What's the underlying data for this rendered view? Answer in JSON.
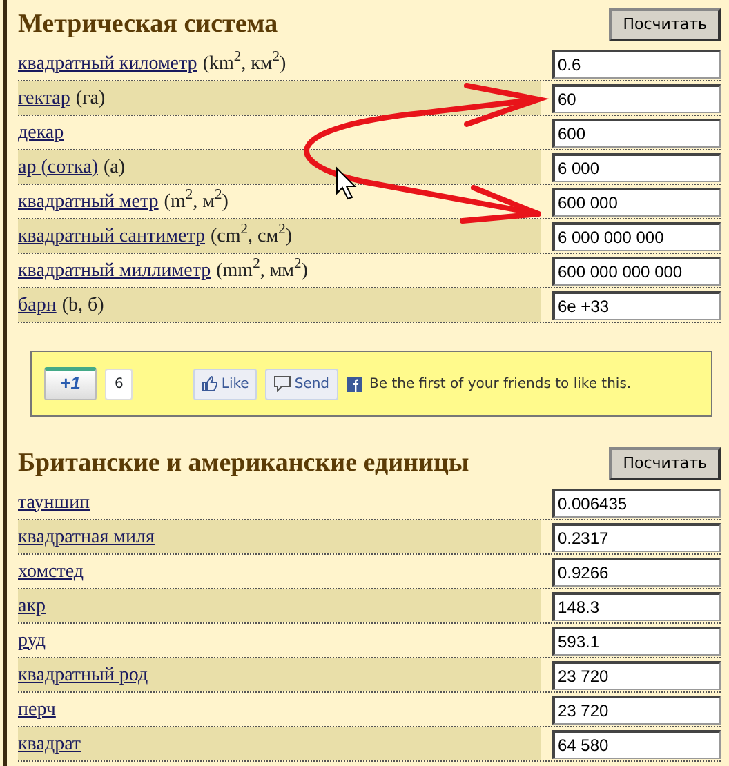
{
  "sections": [
    {
      "title": "Метрическая система",
      "button": "Посчитать",
      "rows": [
        {
          "unit": "квадратный километр",
          "symbol": "(km$^{2}$, км$^{2}$)",
          "value": "0.6"
        },
        {
          "unit": "гектар",
          "symbol": "(га)",
          "value": "60"
        },
        {
          "unit": "декар",
          "value": "600"
        },
        {
          "unit": "ар (сотка)",
          "symbol": "(а)",
          "value": "6 000"
        },
        {
          "unit": "квадратный метр",
          "symbol": "(m$^{2}$, м$^{2}$)",
          "value": "600 000"
        },
        {
          "unit": "квадратный сантиметр",
          "symbol": "(cm$^{2}$, см$^{2}$)",
          "value": "6 000 000 000"
        },
        {
          "unit": "квадратный миллиметр",
          "symbol": "(mm$^{2}$, мм$^{2}$)",
          "value": "600 000 000 000"
        },
        {
          "unit": "барн",
          "symbol": "(b, б)",
          "value": "6e +33"
        }
      ]
    },
    {
      "title": "Британские и американские единицы",
      "button": "Посчитать",
      "rows": [
        {
          "unit": "тауншип",
          "value": "0.006435"
        },
        {
          "unit": "квадратная миля",
          "value": "0.2317"
        },
        {
          "unit": "хомстед",
          "value": "0.9266"
        },
        {
          "unit": "акр",
          "value": "148.3"
        },
        {
          "unit": "руд",
          "value": "593.1"
        },
        {
          "unit": "квадратный род",
          "value": "23 720"
        },
        {
          "unit": "перч",
          "value": "23 720"
        },
        {
          "unit": "квадрат",
          "value": "64 580"
        }
      ]
    }
  ],
  "social": {
    "plus_one": "+1",
    "count": "6",
    "like": "Like",
    "send": "Send",
    "text": "Be the first of your friends to like this."
  }
}
